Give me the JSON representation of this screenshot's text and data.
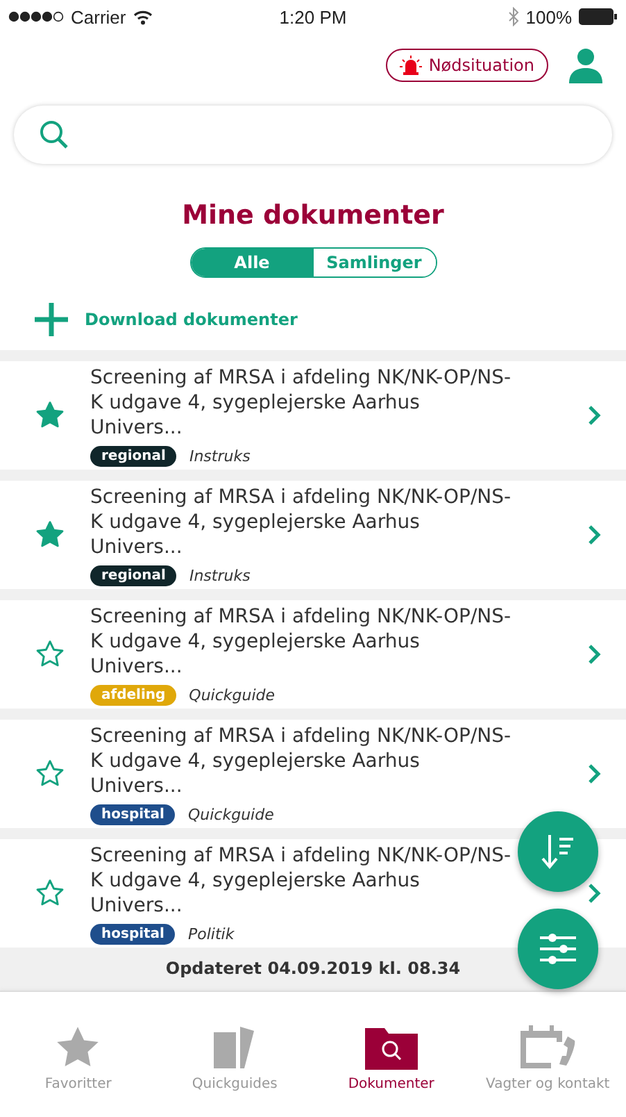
{
  "status_bar": {
    "carrier": "Carrier",
    "time": "1:20 PM",
    "battery": "100%"
  },
  "header": {
    "emergency_button": "Nødsituation"
  },
  "title": "Mine dokumenter",
  "segments": [
    {
      "label": "Alle",
      "selected": true
    },
    {
      "label": "Samlinger",
      "selected": false
    }
  ],
  "download_link": "Download dokumenter",
  "documents": [
    {
      "title": "Screening af MRSA i afdeling NK/NK-OP/NS-K udgave 4, sygeplejerske Aarhus Univers...",
      "favorite": true,
      "tag": "regional",
      "color": "#10262a",
      "type": "Instruks"
    },
    {
      "title": "Screening af MRSA i afdeling NK/NK-OP/NS-K udgave 4, sygeplejerske Aarhus Univers...",
      "favorite": true,
      "tag": "regional",
      "color": "#10262a",
      "type": "Instruks"
    },
    {
      "title": "Screening af MRSA i afdeling NK/NK-OP/NS-K udgave 4, sygeplejerske Aarhus Univers...",
      "favorite": false,
      "tag": "afdeling",
      "color": "#e0a80a",
      "type": "Quickguide"
    },
    {
      "title": "Screening af MRSA i afdeling NK/NK-OP/NS-K udgave 4, sygeplejerske Aarhus Univers...",
      "favorite": false,
      "tag": "hospital",
      "color": "#1f4e8c",
      "type": "Quickguide"
    },
    {
      "title": "Screening af MRSA i afdeling NK/NK-OP/NS-K udgave 4, sygeplejerske Aarhus Univers...",
      "favorite": false,
      "tag": "hospital",
      "color": "#1f4e8c",
      "type": "Politik"
    }
  ],
  "updated": "Opdateret 04.09.2019 kl. 08.34",
  "tab_bar": [
    {
      "label": "Favoritter",
      "kind": "star",
      "selected": false
    },
    {
      "label": "Quickguides",
      "kind": "cards",
      "selected": false
    },
    {
      "label": "Dokumenter",
      "kind": "folder",
      "selected": true
    },
    {
      "label": "Vagter og kontakt",
      "kind": "calendar",
      "selected": false
    }
  ]
}
